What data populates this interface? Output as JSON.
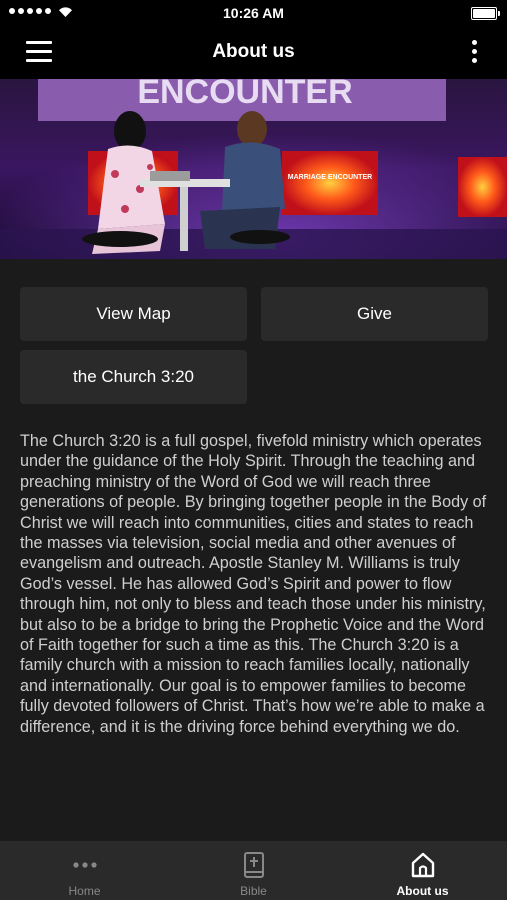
{
  "status_bar": {
    "time": "10:26 AM"
  },
  "nav": {
    "title": "About us"
  },
  "hero": {
    "sign_text": "ENCOUNTER",
    "screen_text": "MARRIAGE ENCOUNTER"
  },
  "buttons": {
    "view_map": "View Map",
    "give": "Give",
    "church": "the Church 3:20"
  },
  "about": {
    "text": "The Church 3:20 is a full gospel, fivefold ministry which operates under the guidance of the Holy Spirit. Through the teaching and preaching ministry of the Word of God we will reach three generations of people. By bringing together people in the Body of Christ we will reach into communities, cities and states to reach the masses via television, social media and other avenues of evangelism and outreach. Apostle Stanley M. Williams is truly God’s vessel. He has allowed God’s Spirit and power to flow through him, not only to bless and teach those under his ministry, but also to be a bridge to bring the Prophetic Voice and the Word of Faith together for such a time as this. The Church 3:20 is a family church with a mission to reach families locally, nationally and internationally. Our goal is to empower families to become fully devoted followers of Christ. That’s how we’re able to make a difference, and it is the driving force behind everything we do."
  },
  "tabs": [
    {
      "label": "Home",
      "icon": "more-dots-icon"
    },
    {
      "label": "Bible",
      "icon": "bible-icon"
    },
    {
      "label": "About us",
      "icon": "home-icon",
      "active": true
    }
  ]
}
